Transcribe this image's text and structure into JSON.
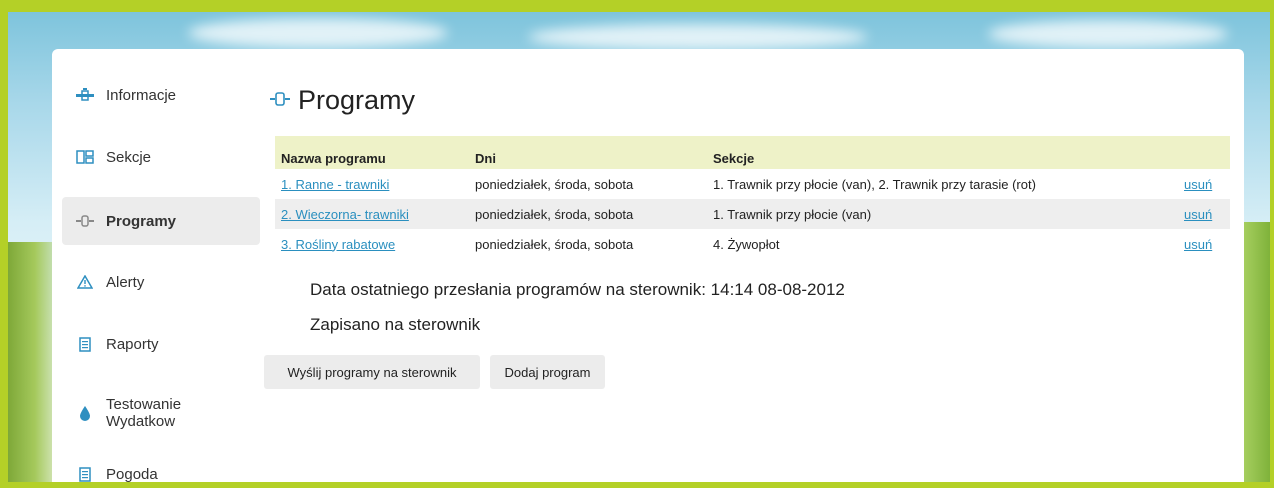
{
  "sidebar": {
    "items": [
      {
        "label": "Informacje",
        "icon": "water-valve-icon"
      },
      {
        "label": "Sekcje",
        "icon": "sections-grid-icon"
      },
      {
        "label": "Programy",
        "icon": "program-valve-icon",
        "active": true
      },
      {
        "label": "Alerty",
        "icon": "warning-triangle-icon"
      },
      {
        "label": "Raporty",
        "icon": "report-document-icon"
      },
      {
        "label": "Testowanie\nWydatkow",
        "icon": "water-drop-icon"
      },
      {
        "label": "Pogoda",
        "icon": "weather-document-icon"
      }
    ]
  },
  "main": {
    "title": "Programy",
    "table": {
      "headers": [
        "Nazwa programu",
        "Dni",
        "Sekcje",
        ""
      ],
      "rows": [
        {
          "name": "1. Ranne - trawniki",
          "days": "poniedziałek, środa, sobota",
          "sections": "1. Trawnik przy płocie (van), 2. Trawnik przy tarasie (rot)",
          "action": "usuń"
        },
        {
          "name": "2. Wieczorna- trawniki",
          "days": "poniedziałek, środa, sobota",
          "sections": "1. Trawnik przy płocie (van)",
          "action": "usuń"
        },
        {
          "name": "3. Rośliny rabatowe",
          "days": "poniedziałek, środa, sobota",
          "sections": "4. Żywopłot",
          "action": "usuń"
        }
      ]
    },
    "last_upload": "Data ostatniego przesłania programów na sterownik: 14:14 08-08-2012",
    "status": "Zapisano na sterownik",
    "buttons": {
      "send": "Wyślij programy na sterownik",
      "add": "Dodaj program"
    }
  },
  "colors": {
    "frame": "#b4d027",
    "link": "#2a8fbf",
    "icon": "#2e8fc0",
    "table_header": "#eef2c8",
    "row_alt": "#eeeeee",
    "active_item": "#ececec"
  }
}
